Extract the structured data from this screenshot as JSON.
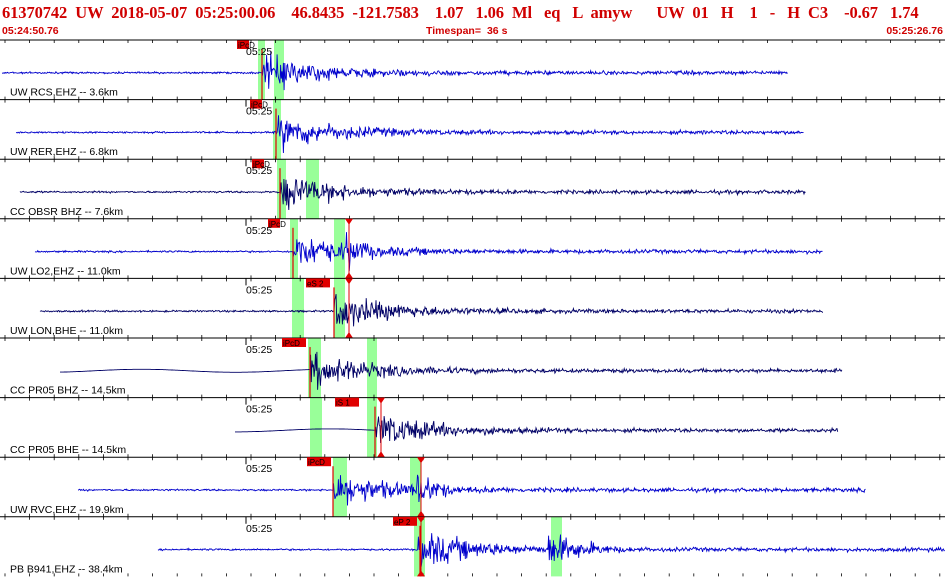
{
  "header": {
    "title": "61370742  UW  2018-05-07  05:25:00.06    46.8435  -121.7583    1.07   1.06  Ml   eq   L  amyw      UW  01   H    1   -   H  C3    -0.67   1.74",
    "start_time": "05:24:50.76",
    "timespan_label": "Timespan=",
    "timespan_value": "36 s",
    "end_time": "05:25:26.76"
  },
  "colors": {
    "header_text": "#d00000",
    "trace_blue": "#0000cc",
    "trace_navy": "#000066",
    "pick_green": "#99ff99",
    "pick_red": "#e00000"
  },
  "channels": [
    {
      "label": "UW RCS,EHZ -- 3.6km",
      "time_label": "05:25",
      "pick_label": "iPcD",
      "color": "blue"
    },
    {
      "label": "UW RER,EHZ -- 6.8km",
      "time_label": "05:25",
      "pick_label": "iPcD",
      "color": "blue"
    },
    {
      "label": "CC OBSR BHZ -- 7.6km",
      "time_label": "05:25",
      "pick_label": "iPcD",
      "color": "navy"
    },
    {
      "label": "UW LO2,EHZ -- 11.0km",
      "time_label": "05:25",
      "pick_label": "iPcD",
      "color": "blue"
    },
    {
      "label": "UW LON,BHE -- 11.0km",
      "time_label": "05:25",
      "pick_label": "eS 2",
      "color": "navy"
    },
    {
      "label": "CC PR05 BHZ -- 14.5km",
      "time_label": "05:25",
      "pick_label": "iPcD",
      "color": "navy"
    },
    {
      "label": "CC PR05 BHE -- 14.5km",
      "time_label": "05:25",
      "pick_label": "iS 1",
      "color": "navy"
    },
    {
      "label": "UW RVC,EHZ -- 19.9km",
      "time_label": "05:25",
      "pick_label": "iPcD",
      "color": "blue"
    },
    {
      "label": "PB B941,EHZ -- 38.4km",
      "time_label": "05:25",
      "pick_label": "eP 2",
      "color": "blue"
    }
  ]
}
